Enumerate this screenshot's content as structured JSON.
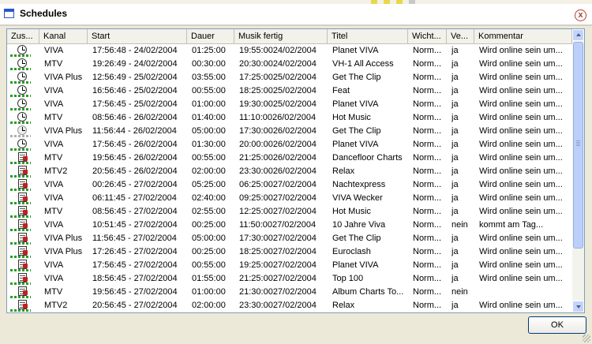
{
  "window": {
    "title": "Schedules",
    "close_glyph": "x"
  },
  "table": {
    "columns": [
      "Zus...",
      "Kanal",
      "Start",
      "Dauer",
      "Musik fertig",
      "Titel",
      "Wicht...",
      "Ve...",
      "Kommentar"
    ],
    "rows": [
      {
        "icon": "clock-icon",
        "cells": [
          "VIVA",
          "17:56:48 - 24/02/2004",
          "01:25:00",
          "19:55:0024/02/2004",
          "Planet VIVA",
          "Norm...",
          "ja",
          "Wird online sein um..."
        ]
      },
      {
        "icon": "clock-icon",
        "cells": [
          "MTV",
          "19:26:49 - 24/02/2004",
          "00:30:00",
          "20:30:0024/02/2004",
          "VH-1 All Access",
          "Norm...",
          "ja",
          "Wird online sein um..."
        ]
      },
      {
        "icon": "clock-icon",
        "cells": [
          "VIVA Plus",
          "12:56:49 - 25/02/2004",
          "03:55:00",
          "17:25:0025/02/2004",
          "Get The Clip",
          "Norm...",
          "ja",
          "Wird online sein um..."
        ]
      },
      {
        "icon": "clock-icon",
        "cells": [
          "VIVA",
          "16:56:46 - 25/02/2004",
          "00:55:00",
          "18:25:0025/02/2004",
          "Feat",
          "Norm...",
          "ja",
          "Wird online sein um..."
        ]
      },
      {
        "icon": "clock-icon",
        "cells": [
          "VIVA",
          "17:56:45 - 25/02/2004",
          "01:00:00",
          "19:30:0025/02/2004",
          "Planet VIVA",
          "Norm...",
          "ja",
          "Wird online sein um..."
        ]
      },
      {
        "icon": "clock-icon",
        "cells": [
          "MTV",
          "08:56:46 - 26/02/2004",
          "01:40:00",
          "11:10:0026/02/2004",
          "Hot Music",
          "Norm...",
          "ja",
          "Wird online sein um..."
        ]
      },
      {
        "icon": "clock-grey-icon",
        "cells": [
          "VIVA Plus",
          "11:56:44 - 26/02/2004",
          "05:00:00",
          "17:30:0026/02/2004",
          "Get The Clip",
          "Norm...",
          "ja",
          "Wird online sein um..."
        ]
      },
      {
        "icon": "clock-icon",
        "cells": [
          "VIVA",
          "17:56:45 - 26/02/2004",
          "01:30:00",
          "20:00:0026/02/2004",
          "Planet VIVA",
          "Norm...",
          "ja",
          "Wird online sein um..."
        ]
      },
      {
        "icon": "document-icon",
        "cells": [
          "MTV",
          "19:56:45 - 26/02/2004",
          "00:55:00",
          "21:25:0026/02/2004",
          "Dancefloor Charts",
          "Norm...",
          "ja",
          "Wird online sein um..."
        ]
      },
      {
        "icon": "document-icon",
        "cells": [
          "MTV2",
          "20:56:45 - 26/02/2004",
          "02:00:00",
          "23:30:0026/02/2004",
          "Relax",
          "Norm...",
          "ja",
          "Wird online sein um..."
        ]
      },
      {
        "icon": "document-icon",
        "cells": [
          "VIVA",
          "00:26:45 - 27/02/2004",
          "05:25:00",
          "06:25:0027/02/2004",
          "Nachtexpress",
          "Norm...",
          "ja",
          "Wird online sein um..."
        ]
      },
      {
        "icon": "document-icon",
        "cells": [
          "VIVA",
          "06:11:45 - 27/02/2004",
          "02:40:00",
          "09:25:0027/02/2004",
          "VIVA Wecker",
          "Norm...",
          "ja",
          "Wird online sein um..."
        ]
      },
      {
        "icon": "document-icon",
        "cells": [
          "MTV",
          "08:56:45 - 27/02/2004",
          "02:55:00",
          "12:25:0027/02/2004",
          "Hot Music",
          "Norm...",
          "ja",
          "Wird online sein um..."
        ]
      },
      {
        "icon": "document-icon",
        "cells": [
          "VIVA",
          "10:51:45 - 27/02/2004",
          "00:25:00",
          "11:50:0027/02/2004",
          "10 Jahre Viva",
          "Norm...",
          "nein",
          "kommt am Tag..."
        ]
      },
      {
        "icon": "document-icon",
        "cells": [
          "VIVA Plus",
          "11:56:45 - 27/02/2004",
          "05:00:00",
          "17:30:0027/02/2004",
          "Get The Clip",
          "Norm...",
          "ja",
          "Wird online sein um..."
        ]
      },
      {
        "icon": "document-icon",
        "cells": [
          "VIVA Plus",
          "17:26:45 - 27/02/2004",
          "00:25:00",
          "18:25:0027/02/2004",
          "Euroclash",
          "Norm...",
          "ja",
          "Wird online sein um..."
        ]
      },
      {
        "icon": "document-icon",
        "cells": [
          "VIVA",
          "17:56:45 - 27/02/2004",
          "00:55:00",
          "19:25:0027/02/2004",
          "Planet VIVA",
          "Norm...",
          "ja",
          "Wird online sein um..."
        ]
      },
      {
        "icon": "document-icon",
        "cells": [
          "VIVA",
          "18:56:45 - 27/02/2004",
          "01:55:00",
          "21:25:0027/02/2004",
          "Top 100",
          "Norm...",
          "ja",
          "Wird online sein um..."
        ]
      },
      {
        "icon": "document-icon",
        "cells": [
          "MTV",
          "19:56:45 - 27/02/2004",
          "01:00:00",
          "21:30:0027/02/2004",
          "Album Charts To...",
          "Norm...",
          "nein",
          ""
        ]
      },
      {
        "icon": "document-icon",
        "cells": [
          "MTV2",
          "20:56:45 - 27/02/2004",
          "02:00:00",
          "23:30:0027/02/2004",
          "Relax",
          "Norm...",
          "ja",
          "Wird online sein um..."
        ]
      }
    ]
  },
  "buttons": {
    "ok_label": "OK"
  }
}
